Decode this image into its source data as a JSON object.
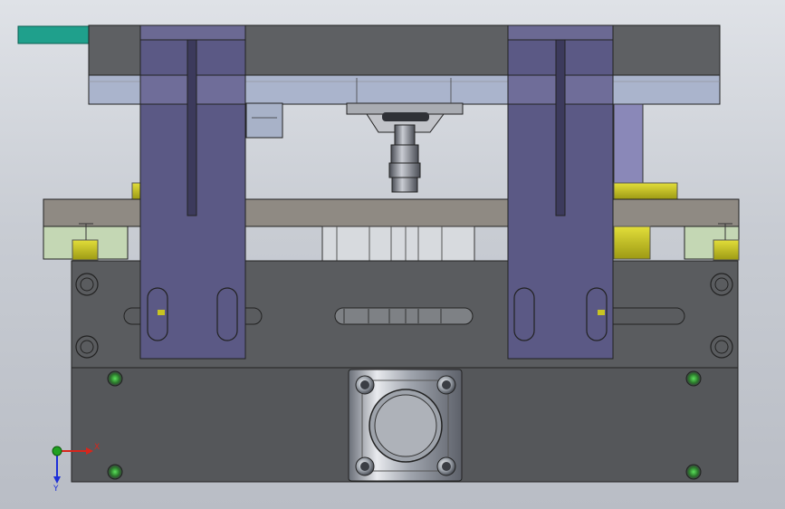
{
  "viewport": {
    "background_top": "#dfe2e7",
    "background_bottom": "#b9bdc5"
  },
  "model": {
    "colors": {
      "dark_steel": "#5b5d60",
      "mid_steel": "#7b7c7f",
      "plate_gray": "#8e8a84",
      "light_blue": "#aab6d0",
      "purple_arm": "#5c5a86",
      "green_block": "#c6d8b6",
      "yellow_part": "#c8c422",
      "teal_tab": "#1fa08c",
      "cylinder_metal": "#b8bcc4"
    }
  },
  "triad": {
    "x_label": "X",
    "y_label": "Y",
    "x_color": "#d8261c",
    "y_color": "#1c2fd8",
    "z_color": "#20a020"
  }
}
